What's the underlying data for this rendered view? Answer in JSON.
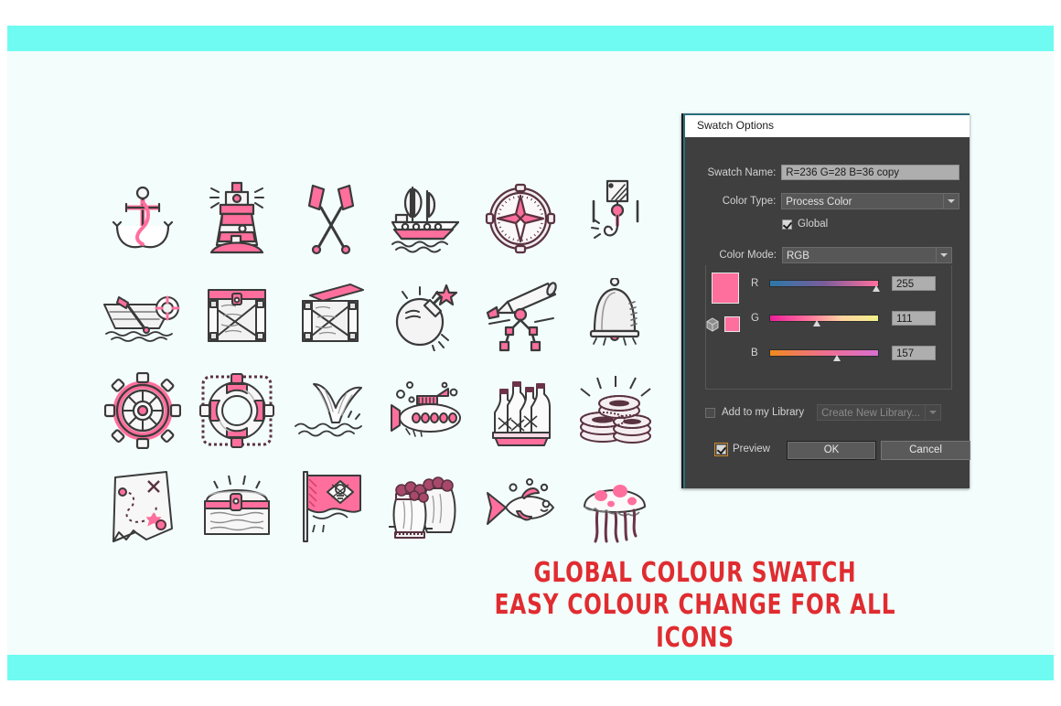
{
  "theme": {
    "band_color": "#6ffbf1",
    "page_bg": "#f3fdfc",
    "accent_pink": "#ff6f9d",
    "tagline_red": "#e02c30",
    "dialog_bg": "#3f3f3f"
  },
  "tagline": {
    "line1": "GLOBAL COLOUR SWATCH",
    "line2": "EASY COLOUR CHANGE FOR ALL ICONS"
  },
  "icons": [
    {
      "name": "anchor",
      "label": "Anchor"
    },
    {
      "name": "lighthouse",
      "label": "Lighthouse"
    },
    {
      "name": "crossed-oars",
      "label": "Crossed Oars"
    },
    {
      "name": "sailing-ship",
      "label": "Sailing Ship"
    },
    {
      "name": "compass",
      "label": "Compass"
    },
    {
      "name": "crane-hook",
      "label": "Crane Hook"
    },
    {
      "name": "rowboat-life-ring",
      "label": "Rowboat with Life Ring"
    },
    {
      "name": "wooden-crate-closed",
      "label": "Wooden Crate"
    },
    {
      "name": "wooden-crate-open",
      "label": "Open Wooden Crate"
    },
    {
      "name": "bomb",
      "label": "Bomb"
    },
    {
      "name": "telescope",
      "label": "Telescope"
    },
    {
      "name": "ship-bell",
      "label": "Ship Bell"
    },
    {
      "name": "ship-wheel",
      "label": "Ship Wheel"
    },
    {
      "name": "life-buoy",
      "label": "Life Buoy"
    },
    {
      "name": "whale-tail",
      "label": "Whale Tail"
    },
    {
      "name": "submarine",
      "label": "Submarine"
    },
    {
      "name": "bottle-crate",
      "label": "Bottle Crate"
    },
    {
      "name": "coin-stacks",
      "label": "Coin Stacks"
    },
    {
      "name": "treasure-map",
      "label": "Treasure Map"
    },
    {
      "name": "treasure-chest",
      "label": "Treasure Chest"
    },
    {
      "name": "pirate-flag",
      "label": "Pirate Flag"
    },
    {
      "name": "barrels",
      "label": "Barrels"
    },
    {
      "name": "fish",
      "label": "Fish"
    },
    {
      "name": "jellyfish",
      "label": "Jellyfish"
    }
  ],
  "dialog": {
    "title": "Swatch Options",
    "swatch_name": {
      "label": "Swatch Name:",
      "value": "R=236 G=28 B=36 copy"
    },
    "color_type": {
      "label": "Color Type:",
      "value": "Process Color"
    },
    "global": {
      "label": "Global",
      "checked": true
    },
    "color_mode": {
      "label": "Color Mode:",
      "value": "RGB"
    },
    "channels": [
      {
        "label": "R",
        "value": "255",
        "percent": 100
      },
      {
        "label": "G",
        "value": "111",
        "percent": 43.5
      },
      {
        "label": "B",
        "value": "157",
        "percent": 61.5
      }
    ],
    "add_to_library": {
      "label": "Add to my Library",
      "checked": false
    },
    "create_library": {
      "value": "Create New Library...",
      "enabled": false
    },
    "preview": {
      "label": "Preview",
      "checked": true
    },
    "ok_label": "OK",
    "cancel_label": "Cancel"
  }
}
